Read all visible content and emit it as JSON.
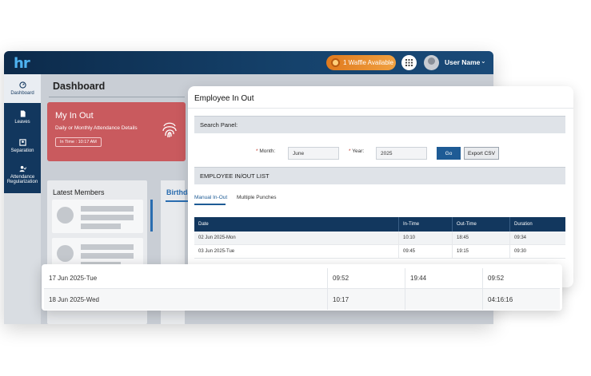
{
  "topbar": {
    "logo": "hr",
    "waffle_label": "1 Waffle Available",
    "user_name": "User Name",
    "chevron": "⌄"
  },
  "sidebar": {
    "items": [
      {
        "label": "Dashboard",
        "icon": "dashboard-icon"
      },
      {
        "label": "Leaves",
        "icon": "document-icon"
      },
      {
        "label": "Separation",
        "icon": "separation-icon"
      },
      {
        "label": "Attendance Regularization",
        "icon": "user-check-icon"
      }
    ]
  },
  "dashboard": {
    "title": "Dashboard",
    "my_in_out": {
      "title": "My In Out",
      "subtitle": "Daily or Monthly Attendance Details",
      "badge": "In Time : 10:17 AM"
    },
    "latest_members": "Latest Members",
    "birthdays": "Birthda"
  },
  "panel": {
    "title": "Employee In Out",
    "search_panel": "Search Panel:",
    "month_label": "Month:",
    "month_value": "June",
    "year_label": "Year:",
    "year_value": "2025",
    "required_mark": "*",
    "go": "Go",
    "export": "Export CSV",
    "list_title": "EMPLOYEE IN/OUT LIST",
    "tabs": [
      "Manual In-Out",
      "Multiple Punches"
    ],
    "columns": [
      "Date",
      "In-Time",
      "Out-Time",
      "Duration"
    ],
    "rows": [
      [
        "02 Jun 2025-Mon",
        "10:10",
        "18:45",
        "09:34"
      ],
      [
        "03 Jun 2025-Tue",
        "09:45",
        "19:15",
        "09:30"
      ]
    ]
  },
  "overlay_rows": [
    [
      "17 Jun 2025-Tue",
      "09:52",
      "19:44",
      "09:52"
    ],
    [
      "18 Jun 2025-Wed",
      "10:17",
      "",
      "04:16:16"
    ]
  ],
  "colors": {
    "navy": "#12375e",
    "accent_blue": "#1e5b95",
    "card_red": "#c95a5e",
    "waffle_orange": "#e98a2c"
  }
}
